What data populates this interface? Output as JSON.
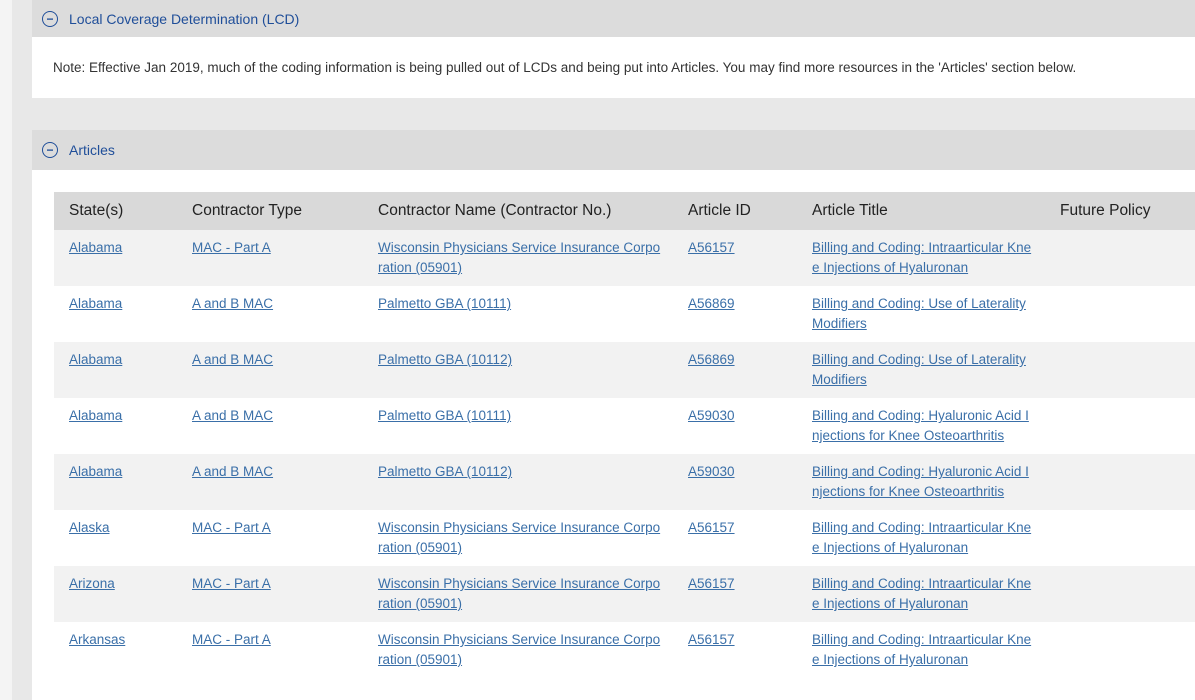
{
  "lcd": {
    "title": "Local Coverage Determination (LCD)",
    "note": "Note: Effective Jan 2019, much of the coding information is being pulled out of LCDs and being put into Articles. You may find more resources in the 'Articles' section below."
  },
  "articles": {
    "title": "Articles",
    "headers": [
      "State(s)",
      "Contractor Type",
      "Contractor Name (Contractor No.)",
      "Article ID",
      "Article Title",
      "Future Policy"
    ],
    "rows": [
      [
        "Alabama",
        "MAC - Part A",
        "Wisconsin Physicians Service Insurance Corporation (05901)",
        "A56157",
        "Billing and Coding: Intraarticular Knee Injections of Hyaluronan"
      ],
      [
        "Alabama",
        "A and B MAC",
        "Palmetto GBA (10111)",
        "A56869",
        "Billing and Coding: Use of Laterality Modifiers"
      ],
      [
        "Alabama",
        "A and B MAC",
        "Palmetto GBA (10112)",
        "A56869",
        "Billing and Coding: Use of Laterality Modifiers"
      ],
      [
        "Alabama",
        "A and B MAC",
        "Palmetto GBA (10111)",
        "A59030",
        "Billing and Coding: Hyaluronic Acid Injections for Knee Osteoarthritis"
      ],
      [
        "Alabama",
        "A and B MAC",
        "Palmetto GBA (10112)",
        "A59030",
        "Billing and Coding: Hyaluronic Acid Injections for Knee Osteoarthritis"
      ],
      [
        "Alaska",
        "MAC - Part A",
        "Wisconsin Physicians Service Insurance Corporation (05901)",
        "A56157",
        "Billing and Coding: Intraarticular Knee Injections of Hyaluronan"
      ],
      [
        "Arizona",
        "MAC - Part A",
        "Wisconsin Physicians Service Insurance Corporation (05901)",
        "A56157",
        "Billing and Coding: Intraarticular Knee Injections of Hyaluronan"
      ],
      [
        "Arkansas",
        "MAC - Part A",
        "Wisconsin Physicians Service Insurance Corporation (05901)",
        "A56157",
        "Billing and Coding: Intraarticular Knee Injections of Hyaluronan"
      ]
    ]
  }
}
